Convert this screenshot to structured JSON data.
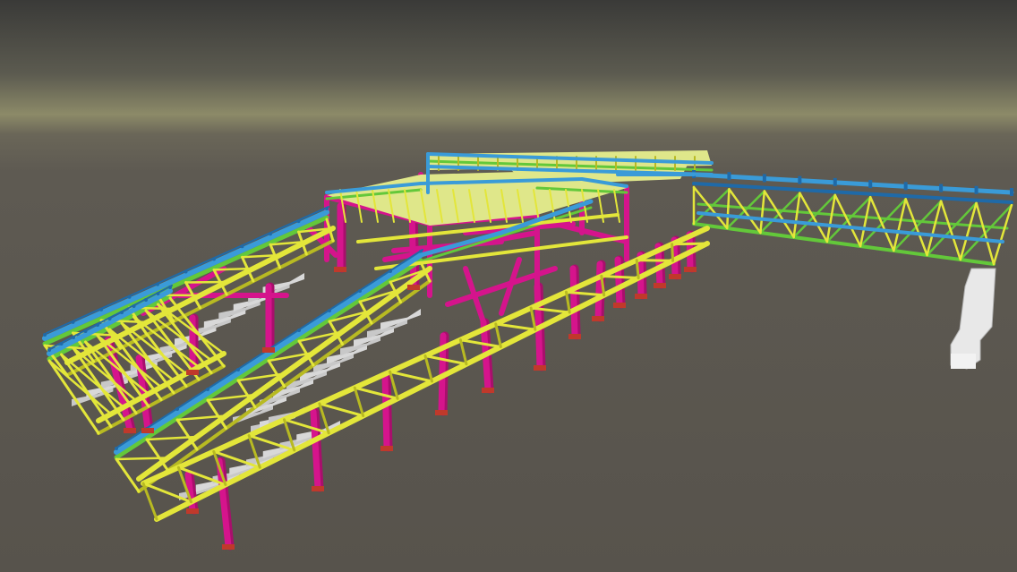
{
  "viewport": {
    "sky_top": "#3e3e3c",
    "horizon_glow": "#8c8a68",
    "ground": "#5b5750",
    "ground_far": "#6a6658"
  },
  "palette": {
    "column": "#d5148c",
    "column_dark": "#a80f6c",
    "bracing": "#e3e63a",
    "bracing_dark": "#b8ba22",
    "handrail": "#3a9bd8",
    "handrail_dark": "#1f6aa8",
    "stringer": "#63c83a",
    "deck": "#dfe78a",
    "stair": "#d8d8d8",
    "stair_shadow": "#9a9a9a",
    "pier": "#e8e8e8",
    "base_plate": "#c0392b"
  },
  "model": {
    "components": [
      "main-platform",
      "upper-deck",
      "left-ramp",
      "center-ramp",
      "front-truss",
      "pedestrian-bridge",
      "support-columns",
      "stairs",
      "concrete-pier"
    ]
  }
}
